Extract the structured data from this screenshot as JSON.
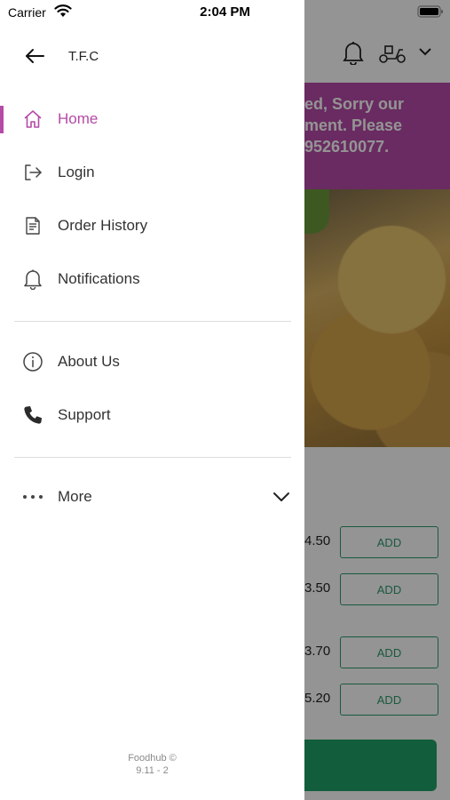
{
  "status_bar": {
    "carrier": "Carrier",
    "time": "2:04 PM"
  },
  "drawer": {
    "store_name": "T.F.C",
    "menu_items": [
      {
        "label": "Home",
        "icon": "home-icon",
        "active": true
      },
      {
        "label": "Login",
        "icon": "login-icon"
      },
      {
        "label": "Order History",
        "icon": "receipt-icon"
      },
      {
        "label": "Notifications",
        "icon": "bell-icon"
      },
      {
        "label": "About Us",
        "icon": "info-icon"
      },
      {
        "label": "Support",
        "icon": "phone-icon"
      },
      {
        "label": "More",
        "icon": "more-dots-icon"
      }
    ],
    "footer": {
      "brand": "Foodhub ©",
      "version": "9.11 - 2"
    }
  },
  "background": {
    "banner_lines": [
      "ed, Sorry our",
      "ment. Please",
      "952610077."
    ],
    "prices": [
      "4.50",
      "3.50",
      "3.70",
      "5.20"
    ],
    "add_label": "ADD"
  },
  "colors": {
    "accent": "#b54aa7",
    "add_green": "#2e9a6b",
    "cart_green": "#1fa067"
  }
}
